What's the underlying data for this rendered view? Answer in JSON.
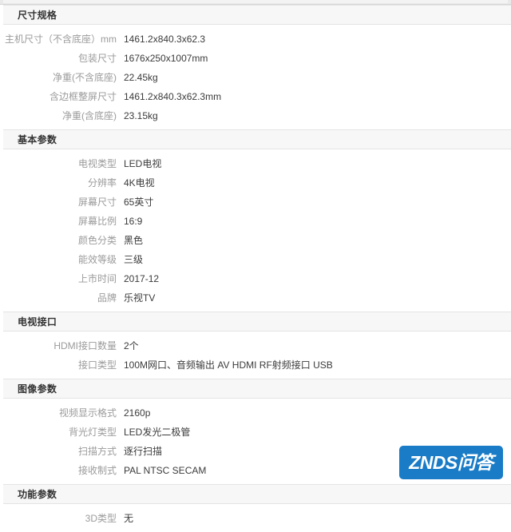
{
  "watermark": {
    "label": "ZNDS问答",
    "background_color": "#1a7cc6",
    "text_color": "#ffffff"
  },
  "colors": {
    "page_background": "#ffffff",
    "section_header_background": "#f7f7f7",
    "section_header_text": "#333333",
    "label_text": "#9b9b9b",
    "value_text": "#3b3b3b",
    "border": "#e4e4e4"
  },
  "sections": [
    {
      "title": "尺寸规格",
      "rows": [
        {
          "label": "主机尺寸（不含底座）mm",
          "value": "1461.2x840.3x62.3"
        },
        {
          "label": "包装尺寸",
          "value": "1676x250x1007mm"
        },
        {
          "label": "净重(不含底座)",
          "value": "22.45kg"
        },
        {
          "label": "含边框整屏尺寸",
          "value": "1461.2x840.3x62.3mm"
        },
        {
          "label": "净重(含底座)",
          "value": "23.15kg"
        }
      ]
    },
    {
      "title": "基本参数",
      "rows": [
        {
          "label": "电视类型",
          "value": "LED电视"
        },
        {
          "label": "分辨率",
          "value": "4K电视"
        },
        {
          "label": "屏幕尺寸",
          "value": "65英寸"
        },
        {
          "label": "屏幕比例",
          "value": "16:9"
        },
        {
          "label": "颜色分类",
          "value": "黑色"
        },
        {
          "label": "能效等级",
          "value": "三级"
        },
        {
          "label": "上市时间",
          "value": "2017-12"
        },
        {
          "label": "品牌",
          "value": "乐视TV"
        }
      ]
    },
    {
      "title": "电视接口",
      "rows": [
        {
          "label": "HDMI接口数量",
          "value": "2个"
        },
        {
          "label": "接口类型",
          "value": "100M网口、音频输出 AV HDMI RF射频接口 USB"
        }
      ]
    },
    {
      "title": "图像参数",
      "rows": [
        {
          "label": "视频显示格式",
          "value": "2160p"
        },
        {
          "label": "背光灯类型",
          "value": "LED发光二极管"
        },
        {
          "label": "扫描方式",
          "value": "逐行扫描"
        },
        {
          "label": "接收制式",
          "value": "PAL NTSC SECAM"
        }
      ]
    },
    {
      "title": "功能参数",
      "rows": [
        {
          "label": "3D类型",
          "value": "无"
        }
      ]
    }
  ]
}
